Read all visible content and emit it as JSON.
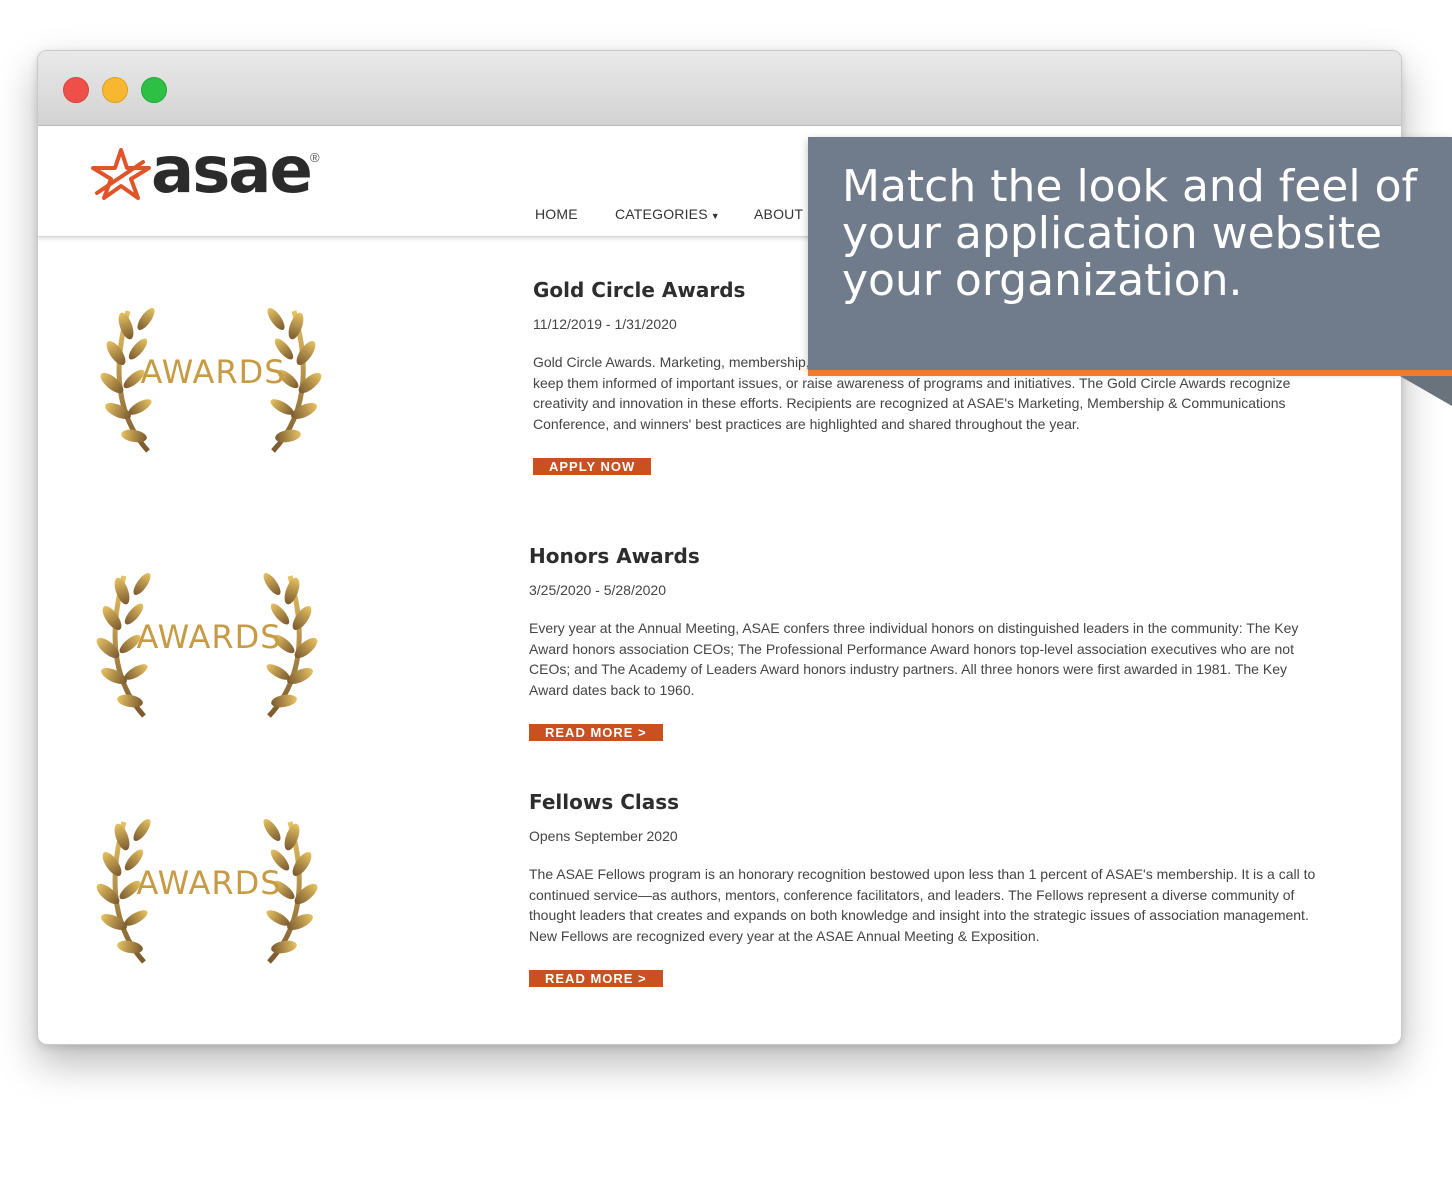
{
  "header": {
    "logo_text": "asae",
    "logo_mark": "®",
    "nav": [
      {
        "label": "HOME"
      },
      {
        "label": "CATEGORIES"
      },
      {
        "label": "ABOUT"
      }
    ]
  },
  "badge_text": "AWARDS",
  "entries": [
    {
      "title": "Gold Circle Awards",
      "date": "11/12/2019 - 1/31/2020",
      "description": "Gold Circle Awards. Marketing, membership, and communications professionals develop campaigns to connect with members, keep them informed of important issues, or raise awareness of programs and initiatives. The Gold Circle Awards recognize creativity and innovation in these efforts. Recipients are recognized at ASAE's Marketing, Membership & Communications Conference, and winners' best practices are highlighted and shared throughout the year.",
      "cta": "APPLY NOW"
    },
    {
      "title": "Honors Awards",
      "date": "3/25/2020 - 5/28/2020",
      "description": "Every year at the Annual Meeting, ASAE confers three individual honors on distinguished leaders in the community: The Key Award honors association CEOs; The Professional Performance Award honors top-level association executives who are not CEOs; and The Academy of Leaders Award honors industry partners. All three honors were first awarded in 1981. The Key Award dates back to 1960.",
      "cta": "READ MORE >"
    },
    {
      "title": "Fellows Class",
      "date": "Opens September 2020",
      "description": "The ASAE Fellows program is an honorary recognition bestowed upon less than 1 percent of ASAE's membership. It is a call to continued service—as authors, mentors, conference facilitators, and leaders. The Fellows represent a diverse community of thought leaders that creates and expands on both knowledge and insight into the strategic issues of association management. New Fellows are recognized every year at the ASAE Annual Meeting & Exposition.",
      "cta": "READ MORE >"
    }
  ],
  "callout": {
    "text": "Match the look and feel of your application website your organization."
  },
  "colors": {
    "accent": "#c8511f",
    "gold": "#c79a44",
    "callout_bg": "#707c8b",
    "callout_bar": "#f07a2d"
  },
  "icons": {
    "logo": "asae-star-logo",
    "badge": "laurel-wreath-icon",
    "dropdown": "caret-down-icon"
  }
}
